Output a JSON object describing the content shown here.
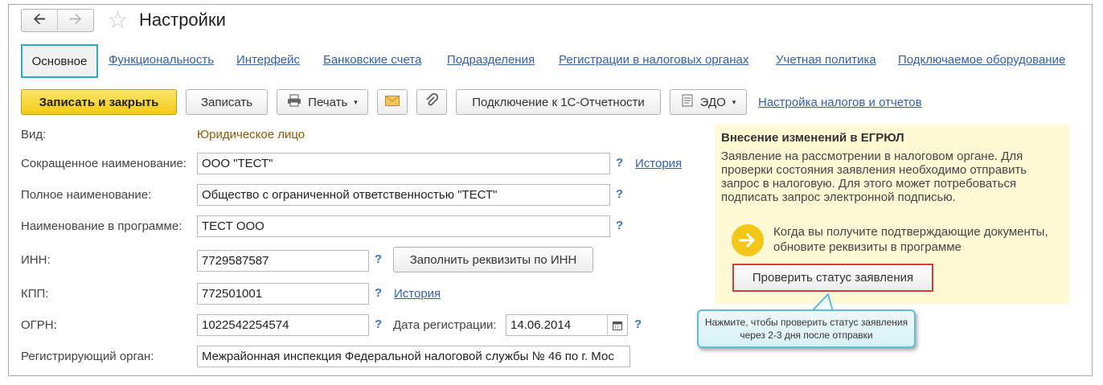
{
  "window": {
    "title": "Настройки"
  },
  "tabs": [
    {
      "label": "Основное",
      "active": true
    },
    {
      "label": "Функциональность"
    },
    {
      "label": "Интерфейс"
    },
    {
      "label": "Банковские счета"
    },
    {
      "label": "Подразделения"
    },
    {
      "label": "Регистрации в налоговых органах"
    },
    {
      "label": "Учетная политика"
    },
    {
      "label": "Подключаемое оборудование"
    }
  ],
  "toolbar": {
    "save_close": "Записать и закрыть",
    "save": "Записать",
    "print": "Печать",
    "connect": "Подключение к 1С-Отчетности",
    "edo": "ЭДО",
    "tax_settings": "Настройка налогов и отчетов"
  },
  "form": {
    "vid_label": "Вид:",
    "vid_value": "Юридическое лицо",
    "short_name_label": "Сокращенное наименование:",
    "short_name_value": "ООО \"ТЕСТ\"",
    "full_name_label": "Полное наименование:",
    "full_name_value": "Общество с ограниченной ответственностью \"ТЕСТ\"",
    "program_name_label": "Наименование в программе:",
    "program_name_value": "ТЕСТ ООО",
    "inn_label": "ИНН:",
    "inn_value": "7729587587",
    "fill_by_inn": "Заполнить реквизиты по ИНН",
    "kpp_label": "КПП:",
    "kpp_value": "772501001",
    "ogrn_label": "ОГРН:",
    "ogrn_value": "1022542254574",
    "reg_date_label": "Дата регистрации:",
    "reg_date_value": "14.06.2014",
    "reg_organ_label": "Регистрирующий орган:",
    "reg_organ_value": "Межрайонная инспекция Федеральной налоговой службы № 46 по г. Мос",
    "history": "История",
    "help": "?"
  },
  "info_panel": {
    "title": "Внесение изменений в ЕГРЮЛ",
    "text": "Заявление на рассмотрении в налоговом органе. Для проверки состояния заявления необходимо отправить запрос в налоговую. Для этого может потребоваться подписать запрос электронной подписью.",
    "arrow_text": "Когда вы получите подтверждающие документы, обновите реквизиты в программе",
    "check_status": "Проверить статус заявления"
  },
  "tooltip": {
    "text": "Нажмите, чтобы проверить статус заявления через 2-3 дня после отправки"
  },
  "colors": {
    "accent_yellow": "#f2ca17",
    "link": "#3560a7",
    "tab_border": "#29a9c0",
    "highlight_red": "#d63a3a",
    "info_bg": "#fff9d6"
  }
}
